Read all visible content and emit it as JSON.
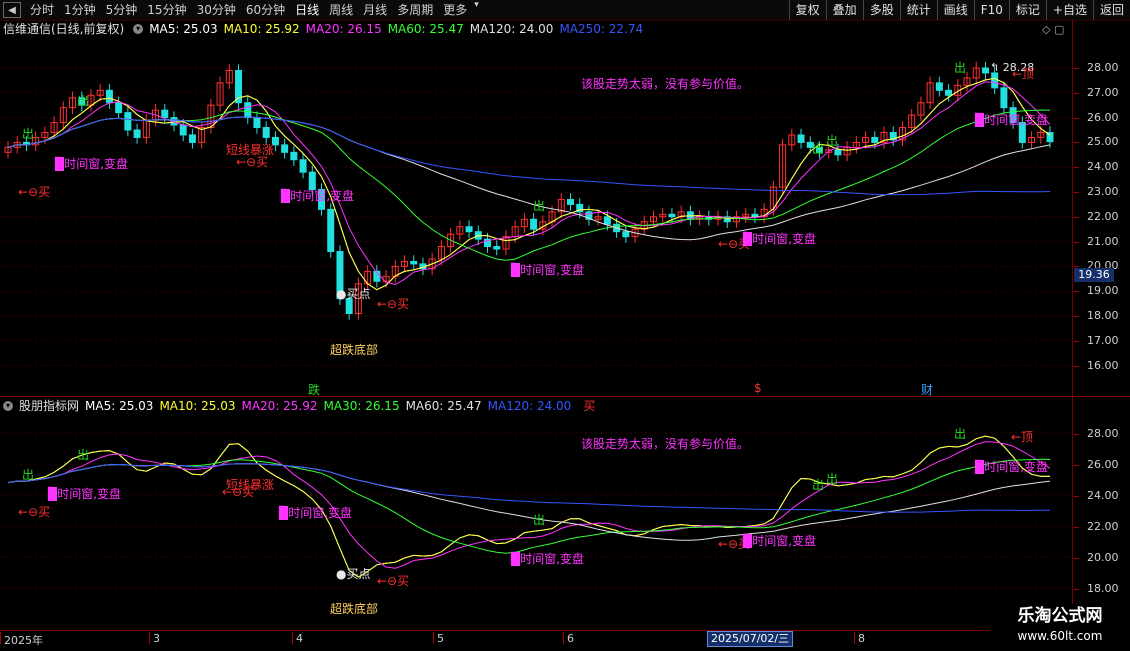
{
  "toolbar": {
    "back_icon": "back-arrow-icon",
    "tabs": [
      {
        "label": "分时"
      },
      {
        "label": "1分钟"
      },
      {
        "label": "5分钟"
      },
      {
        "label": "15分钟"
      },
      {
        "label": "30分钟"
      },
      {
        "label": "60分钟"
      },
      {
        "label": "日线"
      },
      {
        "label": "周线"
      },
      {
        "label": "月线"
      },
      {
        "label": "多周期"
      },
      {
        "label": "更多"
      }
    ],
    "active_tab": "日线",
    "right_buttons": [
      {
        "label": "复权"
      },
      {
        "label": "叠加"
      },
      {
        "label": "多股"
      },
      {
        "label": "统计"
      },
      {
        "label": "画线"
      },
      {
        "label": "F10"
      },
      {
        "label": "标记"
      },
      {
        "label": "+自选"
      },
      {
        "label": "返回"
      }
    ]
  },
  "main_panel": {
    "title": "信维通信(日线,前复权)",
    "ma": [
      {
        "label": "MA5: 25.03",
        "color": "#ffffff"
      },
      {
        "label": "MA10: 25.92",
        "color": "#ffff33"
      },
      {
        "label": "MA20: 26.15",
        "color": "#ff33ff"
      },
      {
        "label": "MA60: 25.47",
        "color": "#33ff33"
      },
      {
        "label": "MA120: 24.00",
        "color": "#e0e0e0"
      },
      {
        "label": "MA250: 22.74",
        "color": "#3355ff"
      }
    ],
    "y_ticks": [
      "28.00",
      "27.00",
      "26.00",
      "25.00",
      "24.00",
      "23.00",
      "22.00",
      "21.00",
      "20.00",
      "19.00",
      "18.00",
      "17.00",
      "16.00"
    ],
    "current_price": "19.36",
    "high_label": "28.28",
    "notice": "该股走势太弱，没有参与价值。",
    "annotations": {
      "out": "出",
      "buy_signal": "←⊖买",
      "buy_signal2": "←⊖买",
      "window": "时间窗,变盘",
      "window2": "时间窗,变盘",
      "window3": "时间窗,变盘",
      "window4": "时间窗,变盘",
      "window5": "时间窗,变盘",
      "short_run": "短线暴涨",
      "buy_point": "买点",
      "bottom": "超跌底部",
      "top": "←顶",
      "event_die": "跌",
      "event_dollar": "$",
      "event_cai": "财"
    }
  },
  "sub_panel": {
    "title": "股朋指标网",
    "ma": [
      {
        "label": "MA5: 25.03",
        "color": "#ffffff"
      },
      {
        "label": "MA10: 25.03",
        "color": "#ffff33"
      },
      {
        "label": "MA20: 25.92",
        "color": "#ff33ff"
      },
      {
        "label": "MA30: 26.15",
        "color": "#33ff33"
      },
      {
        "label": "MA60: 25.47",
        "color": "#e0e0e0"
      },
      {
        "label": "MA120: 24.00",
        "color": "#3355ff"
      }
    ],
    "tail": "买",
    "y_ticks": [
      "28.00",
      "26.00",
      "24.00",
      "22.00",
      "20.00",
      "18.00"
    ],
    "notice": "该股走势太弱，没有参与价值。"
  },
  "date_axis": {
    "labels": [
      "2025年",
      "3",
      "4",
      "5",
      "6",
      "8"
    ],
    "cursor": "2025/07/02/三"
  },
  "watermark": {
    "line1": "乐淘公式网",
    "line2": "www.60lt.com"
  },
  "colors": {
    "up": "#ff3030",
    "down": "#22e0e0",
    "ma5": "#ffffff",
    "ma10": "#ffff33",
    "ma20": "#ff33ff",
    "ma60": "#33ff33",
    "ma120": "#e0e0e0",
    "ma250": "#3355ff"
  },
  "chart_data": {
    "type": "candlestick",
    "closes": [
      24.8,
      25.0,
      24.9,
      25.2,
      25.4,
      25.8,
      26.4,
      26.8,
      26.5,
      26.9,
      27.1,
      26.6,
      26.2,
      25.5,
      25.2,
      25.9,
      26.3,
      26.0,
      25.7,
      25.3,
      25.0,
      25.6,
      26.5,
      27.4,
      27.9,
      26.6,
      26.0,
      25.6,
      25.2,
      24.9,
      24.6,
      24.3,
      23.8,
      23.1,
      22.3,
      20.6,
      18.7,
      18.1,
      19.3,
      19.8,
      19.4,
      19.6,
      20.0,
      20.2,
      20.1,
      19.9,
      20.3,
      20.8,
      21.3,
      21.6,
      21.4,
      21.1,
      20.8,
      20.7,
      21.2,
      21.6,
      21.9,
      21.5,
      21.8,
      22.2,
      22.7,
      22.5,
      22.2,
      21.9,
      22.0,
      21.7,
      21.4,
      21.2,
      21.5,
      21.8,
      22.0,
      22.1,
      22.0,
      22.2,
      21.9,
      22.0,
      21.9,
      22.0,
      21.8,
      22.0,
      22.1,
      22.0,
      22.3,
      23.2,
      24.9,
      25.3,
      25.0,
      24.8,
      24.6,
      24.7,
      24.5,
      24.8,
      25.0,
      25.2,
      25.0,
      25.4,
      25.1,
      25.6,
      26.1,
      26.6,
      27.4,
      27.1,
      26.9,
      27.3,
      27.6,
      28.0,
      27.8,
      27.2,
      26.4,
      25.8,
      25.0,
      25.2,
      25.4,
      25.03
    ],
    "title": "信维通信(日线,前复权)"
  }
}
